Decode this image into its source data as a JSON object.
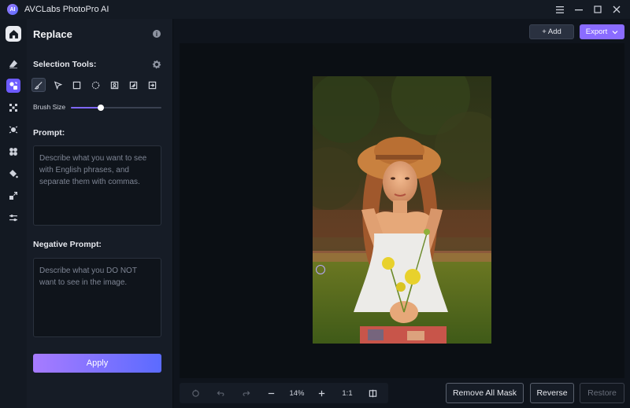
{
  "app": {
    "title": "AVCLabs PhotoPro AI",
    "logo_text": "AI"
  },
  "window_controls": [
    "menu-icon",
    "minimize-icon",
    "maximize-icon",
    "close-icon"
  ],
  "rail": {
    "items": [
      "home-icon",
      "eraser-icon",
      "replace-icon",
      "enhance-icon",
      "background-icon",
      "object-icon",
      "color-icon",
      "upscale-icon",
      "adjust-icon"
    ],
    "active": "replace-icon"
  },
  "panel": {
    "title": "Replace",
    "selection_tools_label": "Selection Tools:",
    "tools": [
      "brush-icon",
      "pointer-icon",
      "rectangle-icon",
      "ellipse-icon",
      "portrait-icon",
      "auto-select-icon",
      "import-icon"
    ],
    "brush_size_label": "Brush Size",
    "brush_size_level": 0.33,
    "prompt_label": "Prompt:",
    "prompt_placeholder": "Describe what you want to see with English phrases, and separate them with commas.",
    "negative_label": "Negative Prompt:",
    "negative_placeholder": "Describe what you DO NOT want to see in the image.",
    "apply_label": "Apply"
  },
  "topbar": {
    "add_label": "+ Add",
    "export_label": "Export"
  },
  "bottom": {
    "zoom": "14%",
    "ratio": "1:1",
    "remove_mask_label": "Remove All Mask",
    "reverse_label": "Reverse",
    "restore_label": "Restore"
  },
  "colors": {
    "accent": "#8a6cff",
    "apply_gradient_start": "#a77bff",
    "apply_gradient_end": "#5b6bff"
  }
}
